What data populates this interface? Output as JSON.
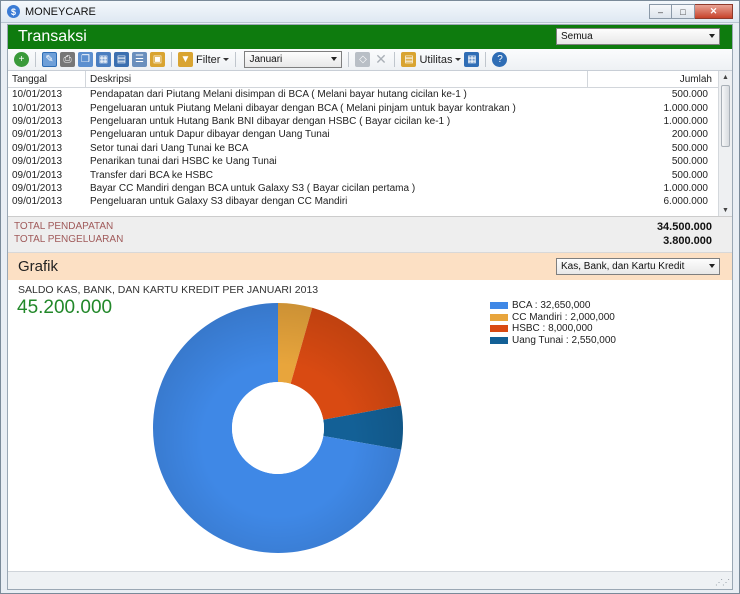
{
  "window": {
    "title": "MONEYCARE",
    "icon_glyph": "$",
    "minimize": "–",
    "maximize": "□",
    "close": "✕"
  },
  "transaksi": {
    "title": "Transaksi",
    "filter_account": "Semua",
    "toolbar": {
      "filter_label": "Filter",
      "month_value": "Januari",
      "utilitas_label": "Utilitas",
      "icons": [
        "add-transaction-icon",
        "edit-icon",
        "print-icon",
        "copy-icon",
        "group-icon",
        "grid-icon",
        "list-icon",
        "calendar-icon",
        "filter-icon",
        "tag-icon",
        "delete-icon",
        "utilitas-icon",
        "table-view-icon",
        "help-icon"
      ]
    },
    "table": {
      "headers": {
        "date": "Tanggal",
        "desc": "Deskripsi",
        "amount": "Jumlah"
      },
      "rows": [
        {
          "date": "10/01/2013",
          "desc": "Pendapatan dari Piutang Melani disimpan di BCA ( Melani bayar hutang cicilan ke-1 )",
          "amount": "500.000"
        },
        {
          "date": "10/01/2013",
          "desc": "Pengeluaran untuk Piutang Melani dibayar dengan BCA ( Melani pinjam untuk bayar kontrakan )",
          "amount": "1.000.000"
        },
        {
          "date": "09/01/2013",
          "desc": "Pengeluaran untuk Hutang Bank BNI dibayar dengan HSBC ( Bayar cicilan ke-1 )",
          "amount": "1.000.000"
        },
        {
          "date": "09/01/2013",
          "desc": "Pengeluaran untuk Dapur dibayar dengan Uang Tunai",
          "amount": "200.000"
        },
        {
          "date": "09/01/2013",
          "desc": "Setor tunai dari Uang Tunai ke BCA",
          "amount": "500.000"
        },
        {
          "date": "09/01/2013",
          "desc": "Penarikan tunai dari HSBC ke Uang Tunai",
          "amount": "500.000"
        },
        {
          "date": "09/01/2013",
          "desc": "Transfer dari BCA ke HSBC",
          "amount": "500.000"
        },
        {
          "date": "09/01/2013",
          "desc": "Bayar CC Mandiri dengan BCA untuk Galaxy S3 ( Bayar cicilan pertama )",
          "amount": "1.000.000"
        },
        {
          "date": "09/01/2013",
          "desc": "Pengeluaran untuk Galaxy S3 dibayar dengan CC Mandiri",
          "amount": "6.000.000"
        }
      ]
    },
    "totals": {
      "income_label": "TOTAL PENDAPATAN",
      "income_value": "34.500.000",
      "expense_label": "TOTAL PENGELUARAN",
      "expense_value": "3.800.000"
    }
  },
  "grafik": {
    "title": "Grafik",
    "chart_select": "Kas, Bank, dan Kartu Kredit",
    "subtitle": "SALDO  KAS, BANK, DAN KARTU KREDIT PER JANUARI 2013",
    "total": "45.200.000",
    "legend": [
      {
        "label": "BCA : 32,650,000"
      },
      {
        "label": "CC Mandiri : 2,000,000"
      },
      {
        "label": "HSBC : 8,000,000"
      },
      {
        "label": "Uang Tunai : 2,550,000"
      }
    ]
  },
  "chart_data": {
    "type": "pie",
    "title": "SALDO  KAS, BANK, DAN KARTU KREDIT PER JANUARI 2013",
    "categories": [
      "BCA",
      "CC Mandiri",
      "HSBC",
      "Uang Tunai"
    ],
    "values": [
      32650000,
      2000000,
      8000000,
      2550000
    ],
    "colors": [
      "#3f88e6",
      "#e8a53c",
      "#d94a12",
      "#136096"
    ],
    "legend_position": "top-right"
  }
}
